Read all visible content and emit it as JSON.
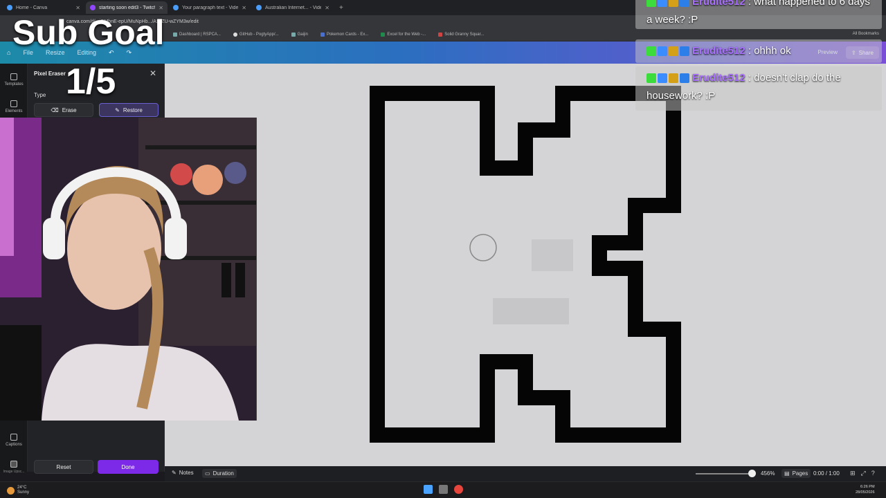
{
  "browser": {
    "tabs": [
      {
        "title": "Home - Canva",
        "active": false
      },
      {
        "title": "starting soon edit3 - Twitch St",
        "active": true
      },
      {
        "title": "Your paragraph text - Video",
        "active": false
      },
      {
        "title": "Australian Internet... - Video",
        "active": false
      }
    ],
    "new_tab": "+",
    "url": "canva.com/d/...iGMbnE-epU/MuNpHb.../Az9ZU-wZYM3w/edit",
    "bookmarks": [
      "Dashboard | RSPCA...",
      "GitHub - PogtyApp/...",
      "Gaijin",
      "Pokemon Cards - Ex...",
      "Excel for the Web -...",
      "Solid Granny Squar..."
    ],
    "all_bookmarks": "All Bookmarks"
  },
  "canva": {
    "menu": [
      "File",
      "Resize",
      "Editing"
    ],
    "preview": "Preview",
    "share": "Share",
    "rail": [
      {
        "label": "Templates"
      },
      {
        "label": "Elements"
      },
      {
        "label": "Captions"
      },
      {
        "label": "Image Upsc..."
      }
    ],
    "panel": {
      "title": "Pixel Eraser",
      "type_label": "Type",
      "erase": "Erase",
      "restore": "Restore",
      "reset": "Reset",
      "done": "Done"
    },
    "bottombar": {
      "notes": "Notes",
      "duration": "Duration",
      "zoom": "456%",
      "zoom_fraction": 0.9,
      "pages": "Pages",
      "time": "0:00 / 1:00"
    }
  },
  "overlay": {
    "sub_goal_title": "Sub Goal",
    "sub_goal_count": "1/5"
  },
  "chat": [
    {
      "user": "Erudite512",
      "text": ": what happened to 6 days a week? :P"
    },
    {
      "user": "Erudite512",
      "text": ": ohhh ok"
    },
    {
      "user": "Erudite512",
      "text": ": doesn't clap do the housework? :P"
    }
  ],
  "taskbar": {
    "weather_temp": "24°C",
    "weather_desc": "Sunny",
    "time": "6:26 PM",
    "date": "28/05/2026"
  },
  "colors": {
    "canva_purple": "#7d2ae8",
    "chat_username": "#a970ff"
  }
}
